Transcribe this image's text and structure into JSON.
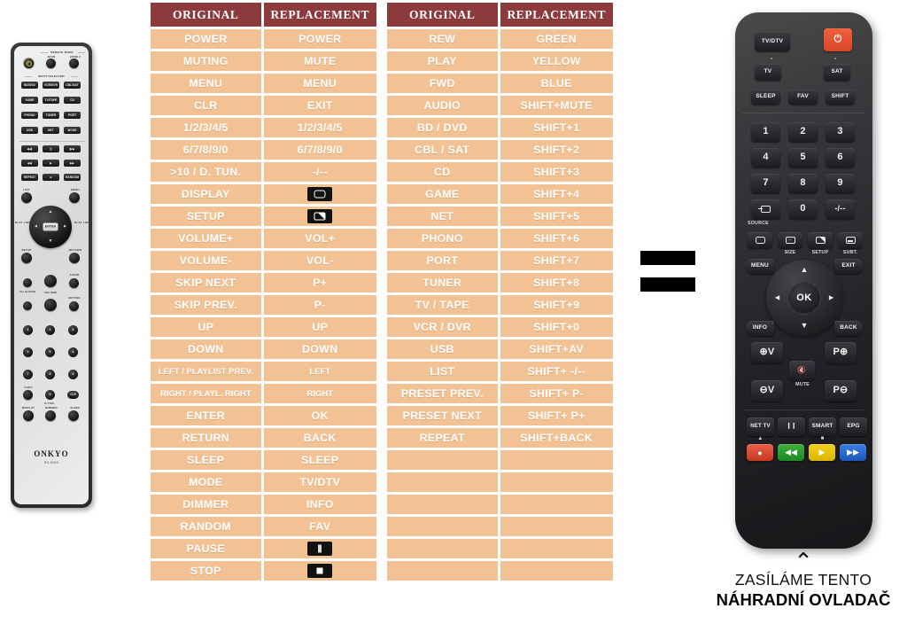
{
  "tables": [
    {
      "id": "table-1",
      "headers": [
        "ORIGINAL",
        "REPLACEMENT"
      ],
      "rows": [
        {
          "original": "POWER",
          "replacement": "POWER"
        },
        {
          "original": "MUTING",
          "replacement": "MUTE"
        },
        {
          "original": "MENU",
          "replacement": "MENU"
        },
        {
          "original": "CLR",
          "replacement": "EXIT"
        },
        {
          "original": "1/2/3/4/5",
          "replacement": "1/2/3/4/5"
        },
        {
          "original": "6/7/8/9/0",
          "replacement": "6/7/8/9/0"
        },
        {
          "original": ">10 / D. TUN.",
          "replacement": "-/--"
        },
        {
          "original": "DISPLAY",
          "replacement": "",
          "replacement_icon": "screen-icon"
        },
        {
          "original": "SETUP",
          "replacement": "",
          "replacement_icon": "setup-screen-icon"
        },
        {
          "original": "VOLUME+",
          "replacement": "VOL+"
        },
        {
          "original": "VOLUME-",
          "replacement": "VOL-"
        },
        {
          "original": "SKIP NEXT",
          "replacement": "P+"
        },
        {
          "original": "SKIP PREV.",
          "replacement": "P-"
        },
        {
          "original": "UP",
          "replacement": "UP"
        },
        {
          "original": "DOWN",
          "replacement": "DOWN"
        },
        {
          "original": "LEFT / PLAYLIST PREV.",
          "replacement": "LEFT",
          "tight": true
        },
        {
          "original": "RIGHT / PLAYL. RIGHT",
          "replacement": "RIGHT",
          "tight": true
        },
        {
          "original": "ENTER",
          "replacement": "OK"
        },
        {
          "original": "RETURN",
          "replacement": "BACK"
        },
        {
          "original": "SLEEP",
          "replacement": "SLEEP"
        },
        {
          "original": "MODE",
          "replacement": "TV/DTV"
        },
        {
          "original": "DIMMER",
          "replacement": "INFO"
        },
        {
          "original": "RANDOM",
          "replacement": "FAV"
        },
        {
          "original": "PAUSE",
          "replacement": "",
          "replacement_icon": "pause-icon"
        },
        {
          "original": "STOP",
          "replacement": "",
          "replacement_icon": "stop-icon"
        }
      ]
    },
    {
      "id": "table-2",
      "headers": [
        "ORIGINAL",
        "REPLACEMENT"
      ],
      "rows": [
        {
          "original": "REW",
          "replacement": "GREEN"
        },
        {
          "original": "PLAY",
          "replacement": "YELLOW"
        },
        {
          "original": "FWD",
          "replacement": "BLUE"
        },
        {
          "original": "AUDIO",
          "replacement": "SHIFT+MUTE"
        },
        {
          "original": "BD / DVD",
          "replacement": "SHIFT+1"
        },
        {
          "original": "CBL / SAT",
          "replacement": "SHIFT+2"
        },
        {
          "original": "CD",
          "replacement": "SHIFT+3"
        },
        {
          "original": "GAME",
          "replacement": "SHIFT+4"
        },
        {
          "original": "NET",
          "replacement": "SHIFT+5"
        },
        {
          "original": "PHONO",
          "replacement": "SHIFT+6"
        },
        {
          "original": "PORT",
          "replacement": "SHIFT+7"
        },
        {
          "original": "TUNER",
          "replacement": "SHIFT+8"
        },
        {
          "original": "TV / TAPE",
          "replacement": "SHIFT+9"
        },
        {
          "original": "VCR / DVR",
          "replacement": "SHIFT+0"
        },
        {
          "original": "USB",
          "replacement": "SHIFT+AV"
        },
        {
          "original": "LIST",
          "replacement": "SHIFT+ -/--"
        },
        {
          "original": "PRESET PREV.",
          "replacement": "SHIFT+ P-"
        },
        {
          "original": "PRESET NEXT",
          "replacement": "SHIFT+ P+"
        },
        {
          "original": "REPEAT",
          "replacement": "SHIFT+BACK"
        },
        {
          "original": "",
          "replacement": ""
        },
        {
          "original": "",
          "replacement": ""
        },
        {
          "original": "",
          "replacement": ""
        },
        {
          "original": "",
          "replacement": ""
        },
        {
          "original": "",
          "replacement": ""
        },
        {
          "original": "",
          "replacement": ""
        }
      ]
    }
  ],
  "equals_sign": {
    "symbol": "="
  },
  "original_remote": {
    "brand": "ONKYO",
    "model": "RC-810S",
    "remote_mode_label": "REMOTE MODE",
    "mode_main": "MAIN",
    "mode_zone2": "ZONE 2",
    "input_selector_label": "INPUT SELECTOR",
    "input_buttons": [
      "BD/DVD",
      "VCR/DVR",
      "CBL/SAT",
      "GAME",
      "TV/TAPE",
      "CD",
      "PHONO",
      "TUNER",
      "PORT",
      "USB",
      "NET",
      "MODE"
    ],
    "transport_buttons": [
      "◀◀|",
      "||",
      "|▶▶",
      "◀◀",
      "▶",
      "▶▶",
      "REPEAT",
      "■",
      "RANDOM"
    ],
    "nav_labels": {
      "list": "LIST",
      "menu": "MENU",
      "play_list_left": "PLAY LIST",
      "play_list_right": "PLAY LIST",
      "enter": "ENTER",
      "setup": "SETUP",
      "return": "RETURN"
    },
    "mid_labels": {
      "ch_album": "CH ALBUM",
      "volume": "VOLUME",
      "audio": "AUDIO",
      "muting": "MUTING"
    },
    "keypad": [
      "1",
      "2",
      "3",
      "4",
      "5",
      "6",
      "7",
      "8",
      "9",
      "0"
    ],
    "bottom_labels": {
      "caps": "CAPS",
      "clr": "CLR",
      "d_tun": "D.TUN.",
      "display": "DISPLAY",
      "dimmer": "DIMMER",
      "sleep": "SLEEP"
    }
  },
  "replacement_remote": {
    "tv_dtv": "TV/DTV",
    "power_icon": "power-icon",
    "tv": "TV",
    "sat": "SAT",
    "sleep": "SLEEP",
    "fav": "FAV",
    "shift": "SHIFT",
    "keypad": [
      "1",
      "2",
      "3",
      "4",
      "5",
      "6",
      "7",
      "8",
      "9"
    ],
    "source_button_icon": "source-icon",
    "zero": "0",
    "dash": "-/--",
    "source_label": "SOURCE",
    "size_label": "SIZE",
    "setup_label": "SETUP",
    "subt_label": "SUBT.",
    "menu": "MENU",
    "exit": "EXIT",
    "ok": "OK",
    "info": "INFO",
    "back": "BACK",
    "vol_up": "⊕V",
    "vol_down": "⊖V",
    "mute_label": "MUTE",
    "prog_up": "P⊕",
    "prog_down": "P⊖",
    "net_tv": "NET TV",
    "pause": "❙❙",
    "smart": "SMART",
    "epg": "EPG",
    "color_buttons": [
      "●",
      "◀◀",
      "▶",
      "▶▶"
    ],
    "color_hexes": [
      "#d8452a",
      "#1d8a22",
      "#dcb500",
      "#1c56bb"
    ]
  },
  "caption": {
    "caret": "⌃",
    "line1": "ZASÍLÁME TENTO",
    "line2": "NÁHRADNÍ OVLADAČ"
  },
  "colors": {
    "header_bg": "#8c3a3c",
    "row_bg": "#f2c294",
    "row_text": "#ffffff",
    "page_bg": "#ffffff"
  }
}
